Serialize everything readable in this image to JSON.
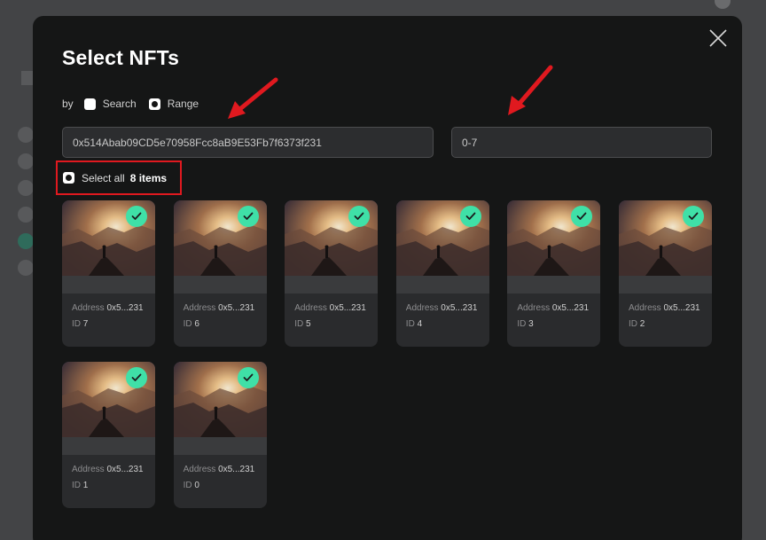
{
  "modal": {
    "title": "Select NFTs",
    "filter": {
      "by_label": "by",
      "search_label": "Search",
      "range_label": "Range"
    },
    "address_input": {
      "value": "0x514Abab09CD5e70958Fcc8aB9E53Fb7f6373f231"
    },
    "range_input": {
      "value": "0-7"
    },
    "select_all": {
      "label": "Select all",
      "count": "8 items"
    }
  },
  "colors": {
    "accent": "#3fe0a7",
    "highlight": "#e0191f",
    "modal_bg": "#151616"
  },
  "icons": {
    "close": "close-icon",
    "check": "checkmark-icon"
  },
  "nfts": [
    {
      "address_label": "Address",
      "address": "0x5...231",
      "id_label": "ID",
      "id": "7"
    },
    {
      "address_label": "Address",
      "address": "0x5...231",
      "id_label": "ID",
      "id": "6"
    },
    {
      "address_label": "Address",
      "address": "0x5...231",
      "id_label": "ID",
      "id": "5"
    },
    {
      "address_label": "Address",
      "address": "0x5...231",
      "id_label": "ID",
      "id": "4"
    },
    {
      "address_label": "Address",
      "address": "0x5...231",
      "id_label": "ID",
      "id": "3"
    },
    {
      "address_label": "Address",
      "address": "0x5...231",
      "id_label": "ID",
      "id": "2"
    },
    {
      "address_label": "Address",
      "address": "0x5...231",
      "id_label": "ID",
      "id": "1"
    },
    {
      "address_label": "Address",
      "address": "0x5...231",
      "id_label": "ID",
      "id": "0"
    }
  ]
}
